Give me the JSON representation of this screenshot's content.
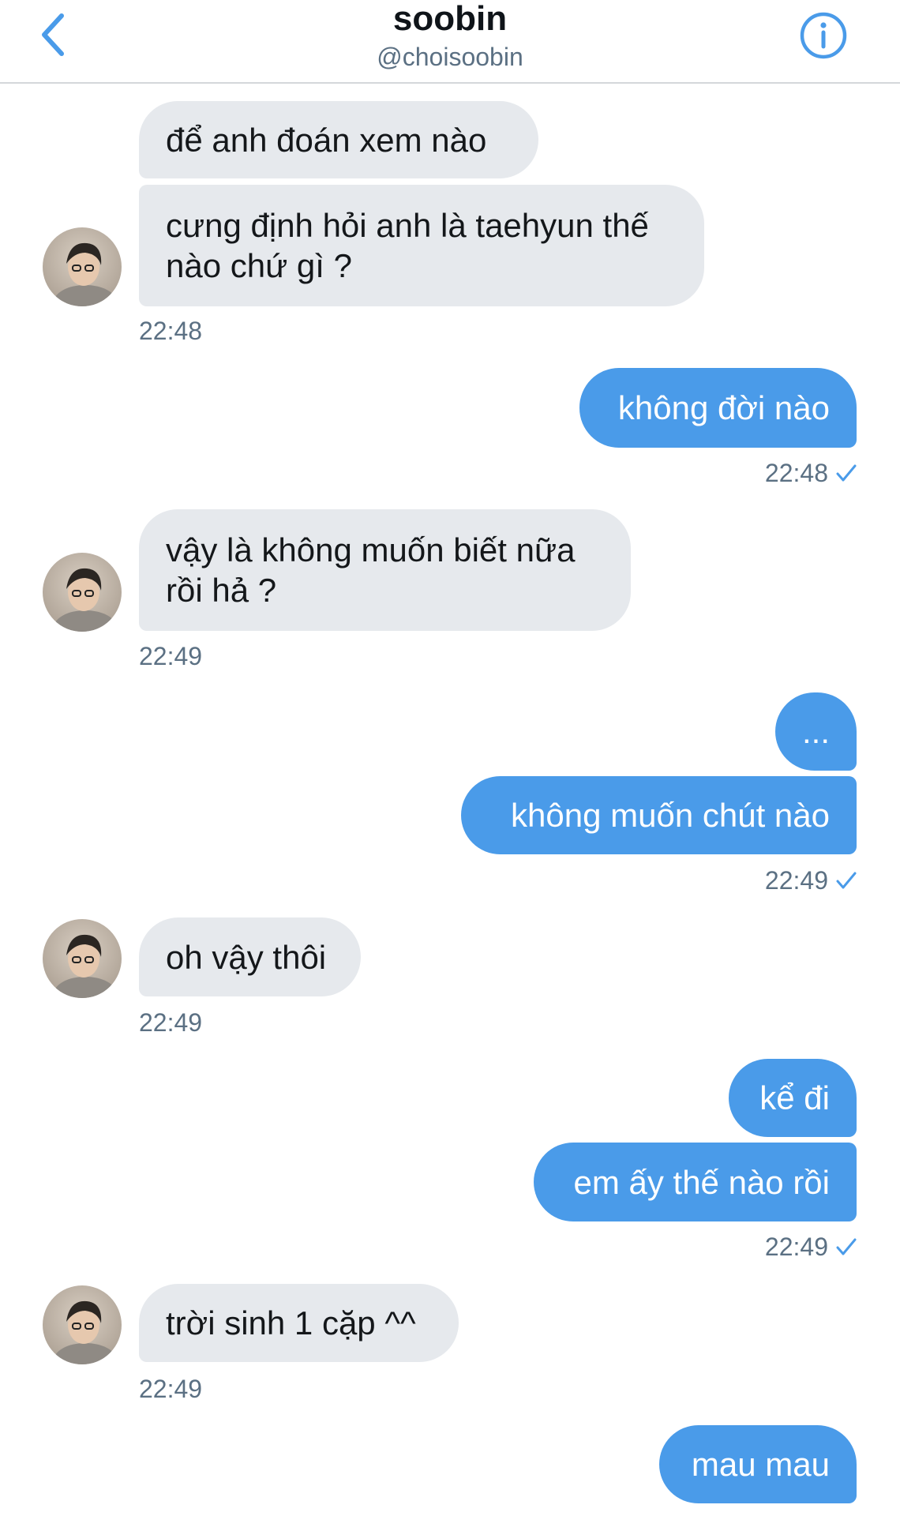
{
  "header": {
    "title": "soobin",
    "handle": "@choisoobin"
  },
  "messages": {
    "m1": "để anh đoán xem nào",
    "m2": "cưng định hỏi anh là taehyun thế\nnào chứ gì ?",
    "t1": "22:48",
    "m3": "không đời nào",
    "t2": "22:48",
    "m4": "vậy là không muốn biết nữa\nrồi hả ?",
    "t3": "22:49",
    "m5": "...",
    "m6": "không muốn chút nào",
    "t4": "22:49",
    "m7": "oh vậy thôi",
    "t5": "22:49",
    "m8": "kể đi",
    "m9": "em ấy thế nào rồi",
    "t6": "22:49",
    "m10": "trời sinh 1 cặp ^^",
    "t7": "22:49",
    "m11": "mau mau"
  },
  "icons": {
    "back": "chevron-left-icon",
    "info": "info-icon",
    "read": "checkmark-icon"
  },
  "colors": {
    "accent": "#4a9be9",
    "incoming_bubble": "#e6e9ed",
    "timestamp": "#5b7083"
  }
}
